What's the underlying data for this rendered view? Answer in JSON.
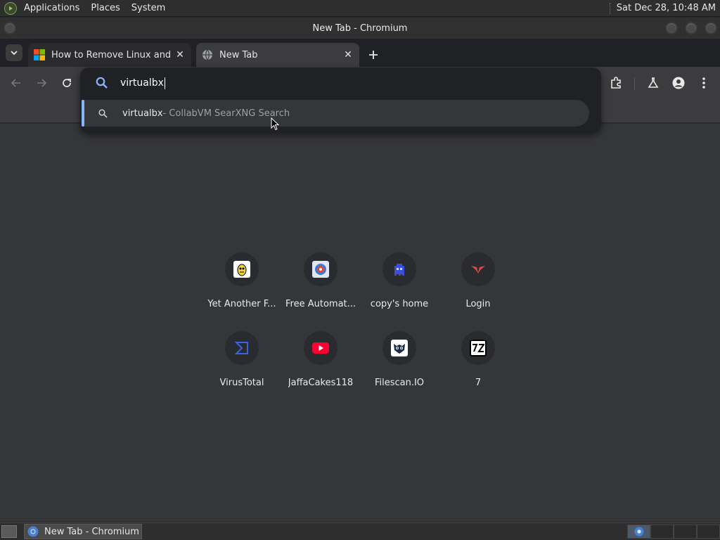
{
  "panel": {
    "menus": [
      "Applications",
      "Places",
      "System"
    ],
    "clock": "Sat Dec 28, 10:48 AM"
  },
  "window": {
    "title": "New Tab - Chromium"
  },
  "tabs": [
    {
      "label": "How to Remove Linux and Ins",
      "favicon": "windows-logo-icon",
      "active": false
    },
    {
      "label": "New Tab",
      "favicon": "globe-icon",
      "active": true
    }
  ],
  "omnibox": {
    "query": "virtualbx",
    "suggestion": {
      "text": "virtualbx",
      "description": " - CollabVM SearXNG Search"
    }
  },
  "shortcuts": [
    {
      "name": "Yet Another F...",
      "icon": "yafgc-icon"
    },
    {
      "name": "Free Automat...",
      "icon": "any-run-icon"
    },
    {
      "name": "copy's home",
      "icon": "pixel-ghost-icon"
    },
    {
      "name": "Login",
      "icon": "red-logo-icon"
    },
    {
      "name": "VirusTotal",
      "icon": "virustotal-icon"
    },
    {
      "name": "JaffaCakes118",
      "icon": "youtube-icon"
    },
    {
      "name": "Filescan.IO",
      "icon": "owl-icon"
    },
    {
      "name": "7",
      "icon": "7zip-icon"
    }
  ],
  "taskbar": {
    "task_label": "New Tab - Chromium"
  },
  "colors": {
    "accent": "#8ab4f8",
    "content_bg": "#35363a",
    "popup_bg": "#202124"
  }
}
